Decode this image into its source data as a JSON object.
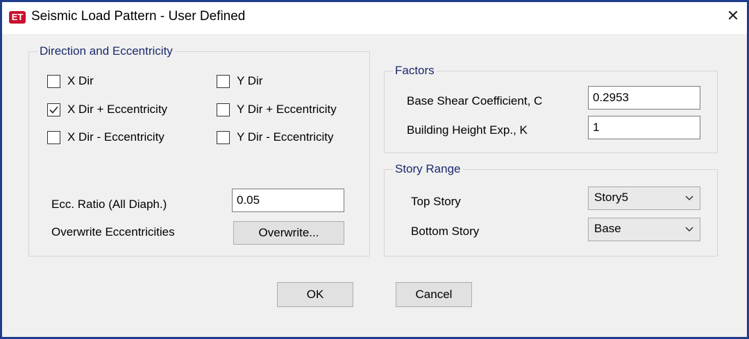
{
  "window": {
    "app_icon_text": "ET",
    "title": "Seismic Load Pattern - User Defined",
    "close_glyph": "✕"
  },
  "direction_group": {
    "legend": "Direction and Eccentricity",
    "checkboxes": [
      {
        "label": "X Dir",
        "checked": false
      },
      {
        "label": "Y Dir",
        "checked": false
      },
      {
        "label": "X Dir + Eccentricity",
        "checked": true
      },
      {
        "label": "Y Dir + Eccentricity",
        "checked": false
      },
      {
        "label": "X Dir - Eccentricity",
        "checked": false
      },
      {
        "label": "Y Dir - Eccentricity",
        "checked": false
      }
    ],
    "ecc_ratio_label": "Ecc. Ratio (All Diaph.)",
    "ecc_ratio_value": "0.05",
    "overwrite_label": "Overwrite Eccentricities",
    "overwrite_button": "Overwrite..."
  },
  "factors_group": {
    "legend": "Factors",
    "base_shear_label": "Base Shear Coefficient, C",
    "base_shear_value": "0.2953",
    "height_exp_label": "Building Height Exp., K",
    "height_exp_value": "1"
  },
  "story_group": {
    "legend": "Story Range",
    "top_label": "Top Story",
    "top_value": "Story5",
    "bottom_label": "Bottom Story",
    "bottom_value": "Base"
  },
  "buttons": {
    "ok": "OK",
    "cancel": "Cancel"
  },
  "colors": {
    "frame_border": "#1f3d8a",
    "group_legend": "#1a2a6c",
    "app_icon": "#c8102e"
  }
}
